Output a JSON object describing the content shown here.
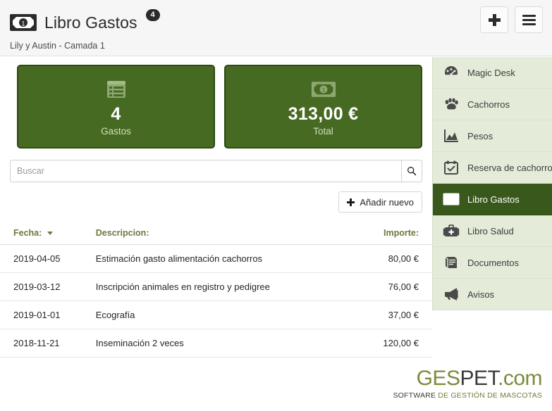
{
  "header": {
    "icon": "banknote-icon",
    "title": "Libro Gastos",
    "badge": "4",
    "subtitle": "Lily y Austin - Camada 1",
    "add_button_icon": "plus-icon",
    "menu_button_icon": "hamburger-menu-icon"
  },
  "cards": [
    {
      "icon": "list-icon",
      "value": "4",
      "label": "Gastos"
    },
    {
      "icon": "banknote-icon",
      "value": "313,00 €",
      "label": "Total"
    }
  ],
  "search": {
    "placeholder": "Buscar",
    "value": "",
    "button_icon": "search-icon"
  },
  "actions": {
    "add_new_label": "Añadir nuevo"
  },
  "table": {
    "columns": [
      "Fecha:",
      "Descripcion:",
      "Importe:"
    ],
    "sort_column": "Fecha:",
    "sort_direction": "desc",
    "rows": [
      {
        "fecha": "2019-04-05",
        "descripcion": "Estimación gasto alimentación cachorros",
        "importe": "80,00 €"
      },
      {
        "fecha": "2019-03-12",
        "descripcion": "Inscripción animales en registro y pedigree",
        "importe": "76,00 €"
      },
      {
        "fecha": "2019-01-01",
        "descripcion": "Ecografía",
        "importe": "37,00 €"
      },
      {
        "fecha": "2018-11-21",
        "descripcion": "Inseminación 2 veces",
        "importe": "120,00 €"
      }
    ]
  },
  "sidebar": {
    "items": [
      {
        "label": "Magic Desk",
        "icon": "gauge-icon",
        "active": false
      },
      {
        "label": "Cachorros",
        "icon": "paw-icon",
        "active": false
      },
      {
        "label": "Pesos",
        "icon": "area-chart-icon",
        "active": false
      },
      {
        "label": "Reserva de cachorros",
        "icon": "calendar-check-icon",
        "active": false
      },
      {
        "label": "Libro Gastos",
        "icon": "banknote-icon",
        "active": true
      },
      {
        "label": "Libro Salud",
        "icon": "medical-bag-icon",
        "active": false
      },
      {
        "label": "Documentos",
        "icon": "book-icon",
        "active": false
      },
      {
        "label": "Avisos",
        "icon": "megaphone-icon",
        "active": false
      }
    ]
  },
  "footer": {
    "logo_part1": "GES",
    "logo_part2": "PET",
    "logo_part3": ".com",
    "tagline_part1": "SOFTWARE ",
    "tagline_part2": "DE GESTIÓN DE MASCOTAS"
  },
  "colors": {
    "card_green": "#476a23",
    "sidebar_bg": "#e4ecd9",
    "active_green": "#39591c",
    "header_olive": "#6b7c3c",
    "logo_olive": "#7a8c3a"
  }
}
